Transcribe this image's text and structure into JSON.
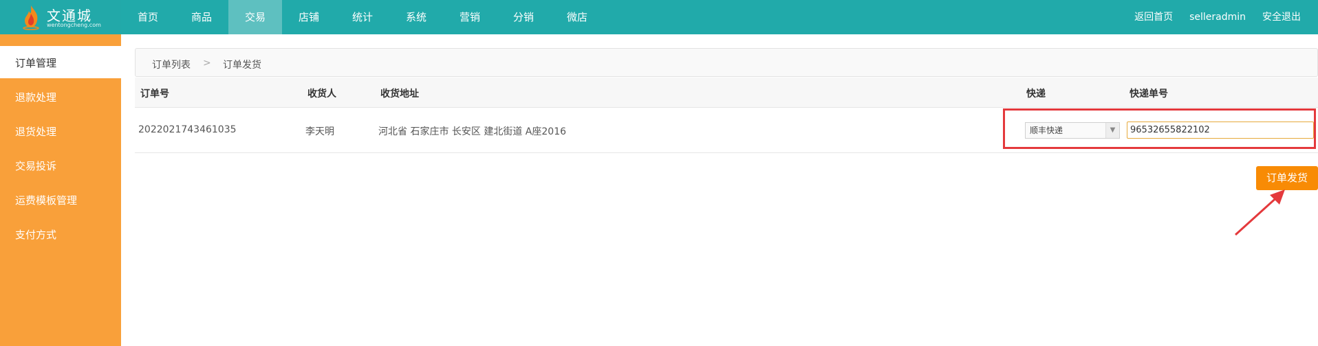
{
  "brand": {
    "name": "文通城",
    "sub": "wentongcheng.com"
  },
  "nav": [
    "首页",
    "商品",
    "交易",
    "店铺",
    "统计",
    "系统",
    "营销",
    "分销",
    "微店"
  ],
  "nav_active_index": 2,
  "right_nav": [
    "返回首页",
    "selleradmin",
    "安全退出"
  ],
  "sidebar": [
    "订单管理",
    "退款处理",
    "退货处理",
    "交易投诉",
    "运费模板管理",
    "支付方式"
  ],
  "breadcrumb": {
    "first": "订单列表",
    "sep": ">",
    "current": "订单发货"
  },
  "table": {
    "headers": [
      "订单号",
      "收货人",
      "收货地址",
      "快递",
      "快递单号"
    ],
    "row": {
      "order_no": "2022021743461035",
      "receiver": "李天明",
      "address": "河北省 石家庄市 长安区 建北街道 A座2016",
      "courier": "顺丰快递",
      "tracking_no": "96532655822102"
    }
  },
  "ship_button": "订单发货",
  "colors": {
    "topbar": "#21aaaa",
    "sidebar": "#f9a03a",
    "button": "#f88b05",
    "highlight": "#e4393c"
  }
}
